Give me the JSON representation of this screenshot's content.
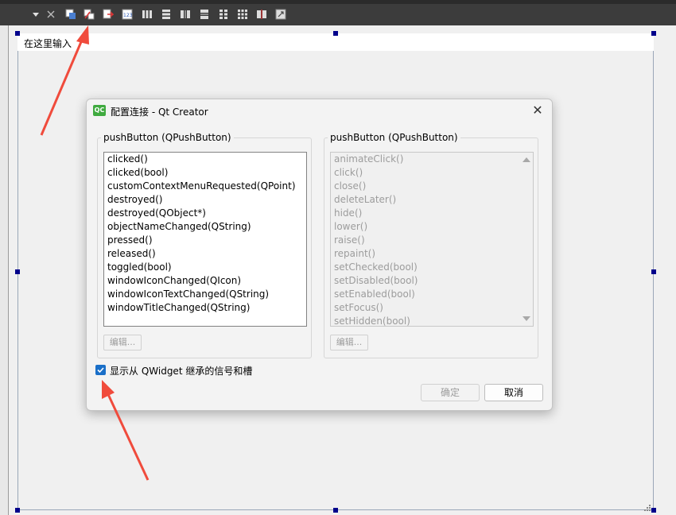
{
  "form": {
    "placeholder_label": "在这里输入"
  },
  "toolbar": {
    "icons": [
      "dropdown-arrow-icon",
      "close-x-icon",
      "edit-widgets-icon",
      "edit-signals-slots-icon",
      "edit-buddies-icon",
      "edit-tab-order-icon",
      "layout-horizontal-icon",
      "layout-vertical-icon",
      "splitter-horizontal-icon",
      "splitter-vertical-icon",
      "layout-form-icon",
      "layout-grid-icon",
      "break-layout-icon",
      "adjust-size-icon"
    ]
  },
  "dialog": {
    "title": "配置连接 - Qt Creator",
    "close_glyph": "✕",
    "logo_text": "QC",
    "left_group": {
      "title": "pushButton (QPushButton)",
      "items": [
        "clicked()",
        "clicked(bool)",
        "customContextMenuRequested(QPoint)",
        "destroyed()",
        "destroyed(QObject*)",
        "objectNameChanged(QString)",
        "pressed()",
        "released()",
        "toggled(bool)",
        "windowIconChanged(QIcon)",
        "windowIconTextChanged(QString)",
        "windowTitleChanged(QString)"
      ],
      "edit_label": "编辑..."
    },
    "right_group": {
      "title": "pushButton (QPushButton)",
      "items": [
        "animateClick()",
        "click()",
        "close()",
        "deleteLater()",
        "hide()",
        "lower()",
        "raise()",
        "repaint()",
        "setChecked(bool)",
        "setDisabled(bool)",
        "setEnabled(bool)",
        "setFocus()",
        "setHidden(bool)"
      ],
      "edit_label": "编辑..."
    },
    "checkbox": {
      "label": "显示从 QWidget 继承的信号和槽",
      "checked": true
    },
    "ok_label": "确定",
    "cancel_label": "取消"
  },
  "colors": {
    "accent": "#1a6fc8",
    "arrow": "#f04b3c",
    "toolbar_bg": "#3c3c3c",
    "selection_handle": "#00008b"
  }
}
